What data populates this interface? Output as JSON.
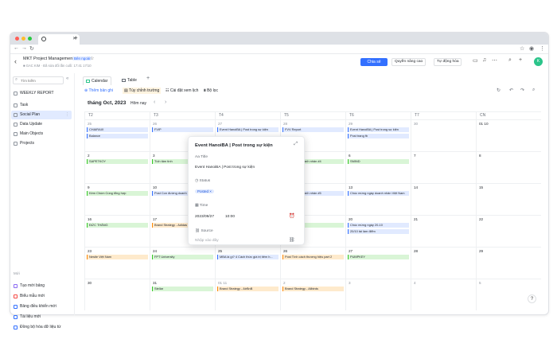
{
  "browser": {
    "dots": [
      "#ff5f57",
      "#febc2e",
      "#28c840"
    ],
    "tab_close": "✕",
    "new_tab": "+"
  },
  "header": {
    "title": "MKT Project Management",
    "badge": "Bên ngoài",
    "meta": "■ GAC KIM  ·  Đã sửa đổi lần cuối: 17:41 17/10",
    "share": "Chia sẻ",
    "advanced": "Quyền nâng cao",
    "automation": "Tự động hóa",
    "avatar": "K"
  },
  "sidebar": {
    "search_placeholder": "Tìm kiếm",
    "items": [
      {
        "label": "WEEKLY REPORT",
        "active": false
      },
      {
        "label": "Task",
        "active": false
      },
      {
        "label": "Social Plan",
        "active": true
      },
      {
        "label": "Data Update",
        "active": false
      },
      {
        "label": "Main Objects",
        "active": false
      },
      {
        "label": "Projects",
        "active": false
      }
    ],
    "section_label": "Mới",
    "add_items": [
      {
        "label": "Tạo mới bảng",
        "color": "#8c6cf2"
      },
      {
        "label": "Biểu mẫu mới",
        "color": "#f54a45"
      },
      {
        "label": "Bảng điều khiển mới",
        "color": "#3370ff"
      },
      {
        "label": "Tài liệu mới",
        "color": "#3370ff"
      },
      {
        "label": "Đồng bộ hóa dữ liệu từ",
        "color": "#3370ff"
      }
    ]
  },
  "views": {
    "calendar": "Calendar",
    "table": "Table",
    "add": "+"
  },
  "toolbar": {
    "add_plan": "Thêm bản ghi",
    "settings": "Tùy chỉnh trường",
    "color": "Cài đặt xem lịch",
    "filter": "Bộ lọc"
  },
  "calendar": {
    "month": "tháng Oct, 2023",
    "today": "Hôm nay",
    "prev": "‹",
    "next": "›",
    "days": [
      "T2",
      "T3",
      "T4",
      "T5",
      "T6",
      "T7",
      "CN"
    ],
    "weeks": [
      [
        {
          "d": "25",
          "grey": true,
          "ev": [
            {
              "t": "CHAIRAIX",
              "c": "blue"
            },
            {
              "t": "Balance",
              "c": "blue"
            }
          ]
        },
        {
          "d": "26",
          "grey": true,
          "ev": [
            {
              "t": "FVIP",
              "c": "blue"
            }
          ]
        },
        {
          "d": "27",
          "grey": true,
          "ev": [
            {
              "t": "Event HanoiBA | Post trong sự kiện",
              "c": "blue"
            }
          ]
        },
        {
          "d": "28",
          "grey": true,
          "ev": [
            {
              "t": "FVV Report",
              "c": "blue"
            }
          ]
        },
        {
          "d": "29",
          "grey": true,
          "ev": [
            {
              "t": "Event HanoiBA | Post trong sự kiện",
              "c": "blue"
            },
            {
              "t": "Post trang fb",
              "c": "blue"
            }
          ]
        },
        {
          "d": "30",
          "grey": true,
          "ev": []
        },
        {
          "d": "01 10",
          "grey": false,
          "ev": []
        }
      ],
      [
        {
          "d": "2",
          "grey": false,
          "ev": [
            {
              "t": "SAPETKOY",
              "c": "green"
            }
          ]
        },
        {
          "d": "3",
          "grey": false,
          "ev": [
            {
              "t": "Tích tâm tình",
              "c": "green"
            }
          ]
        },
        {
          "d": "4",
          "grey": false,
          "ev": []
        },
        {
          "d": "5",
          "grey": false,
          "ev": [
            {
              "t": "Post thành doanh nhân #4",
              "c": "green"
            }
          ]
        },
        {
          "d": "6",
          "grey": false,
          "ev": [
            {
              "t": "SMIND",
              "c": "green"
            }
          ]
        },
        {
          "d": "7",
          "grey": false,
          "ev": []
        },
        {
          "d": "8",
          "grey": false,
          "ev": []
        }
      ],
      [
        {
          "d": "9",
          "grey": false,
          "ev": [
            {
              "t": "Kèm Chùm Cùng tổng hợp",
              "c": "green"
            }
          ]
        },
        {
          "d": "10",
          "grey": false,
          "ev": [
            {
              "t": "Post Con đường doanh nhân",
              "c": "blue"
            }
          ]
        },
        {
          "d": "11",
          "grey": false,
          "ev": []
        },
        {
          "d": "12",
          "grey": false,
          "ev": [
            {
              "t": "Post thành doanh nhân #5",
              "c": "blue"
            }
          ]
        },
        {
          "d": "13",
          "grey": false,
          "ev": [
            {
              "t": "Chúc mừng ngày doanh nhân Việt Nam",
              "c": "blue"
            }
          ]
        },
        {
          "d": "14",
          "grey": false,
          "ev": []
        },
        {
          "d": "15",
          "grey": false,
          "ev": []
        }
      ],
      [
        {
          "d": "16",
          "grey": false,
          "ev": [
            {
              "t": "ĐỨC THẮNG",
              "c": "green"
            }
          ]
        },
        {
          "d": "17",
          "grey": false,
          "ev": [
            {
              "t": "Brand Strategy - Adidas",
              "c": "orange"
            }
          ]
        },
        {
          "d": "18",
          "grey": false,
          "ev": []
        },
        {
          "d": "19",
          "grey": false,
          "ev": [
            {
              "t": "",
              "c": "green"
            }
          ]
        },
        {
          "d": "20",
          "grey": false,
          "ev": [
            {
              "t": "Chúc mừng ngày 20-10",
              "c": "blue"
            },
            {
              "t": "20/10 tài làm điểm",
              "c": "blue"
            }
          ]
        },
        {
          "d": "21",
          "grey": false,
          "ev": []
        },
        {
          "d": "22",
          "grey": false,
          "ev": []
        }
      ],
      [
        {
          "d": "23",
          "grey": false,
          "ev": [
            {
              "t": "Nestle Việt Nam",
              "c": "orange"
            }
          ]
        },
        {
          "d": "24",
          "grey": false,
          "ev": [
            {
              "t": "FPT University",
              "c": "green"
            }
          ]
        },
        {
          "d": "25",
          "grey": false,
          "ev": [
            {
              "t": "MBA là gì? 4 Cách thức giá trị tiêm h...",
              "c": "blue"
            }
          ]
        },
        {
          "d": "26",
          "grey": false,
          "ev": [
            {
              "t": "Post Tính cách thương hiệu part 2",
              "c": "orange"
            }
          ]
        },
        {
          "d": "27",
          "grey": false,
          "ev": [
            {
              "t": "PUMPKEY",
              "c": "green"
            }
          ]
        },
        {
          "d": "28",
          "grey": false,
          "ev": []
        },
        {
          "d": "29",
          "grey": false,
          "ev": []
        }
      ],
      [
        {
          "d": "30",
          "grey": false,
          "ev": []
        },
        {
          "d": "31",
          "grey": false,
          "ev": [
            {
              "t": "Stellar",
              "c": "green"
            }
          ]
        },
        {
          "d": "01 11",
          "grey": true,
          "ev": [
            {
              "t": "Brand Strategy - AirBnB",
              "c": "orange"
            }
          ]
        },
        {
          "d": "2",
          "grey": true,
          "ev": [
            {
              "t": "Brand Strategy - Allbirds",
              "c": "orange"
            }
          ]
        },
        {
          "d": "3",
          "grey": true,
          "ev": []
        },
        {
          "d": "4",
          "grey": true,
          "ev": []
        },
        {
          "d": "5",
          "grey": true,
          "ev": []
        }
      ]
    ]
  },
  "popover": {
    "title": "Event HanoiBA | Post trong sự kiện",
    "title_label": "Title",
    "title_value": "Event HanoiBA | Post trong sự kiện",
    "status_label": "Status",
    "status_value": "Posted",
    "time_label": "Time",
    "date": "2023/09/27",
    "time": "10:00",
    "source_label": "Source",
    "source_placeholder": "Nhập vào đây"
  }
}
